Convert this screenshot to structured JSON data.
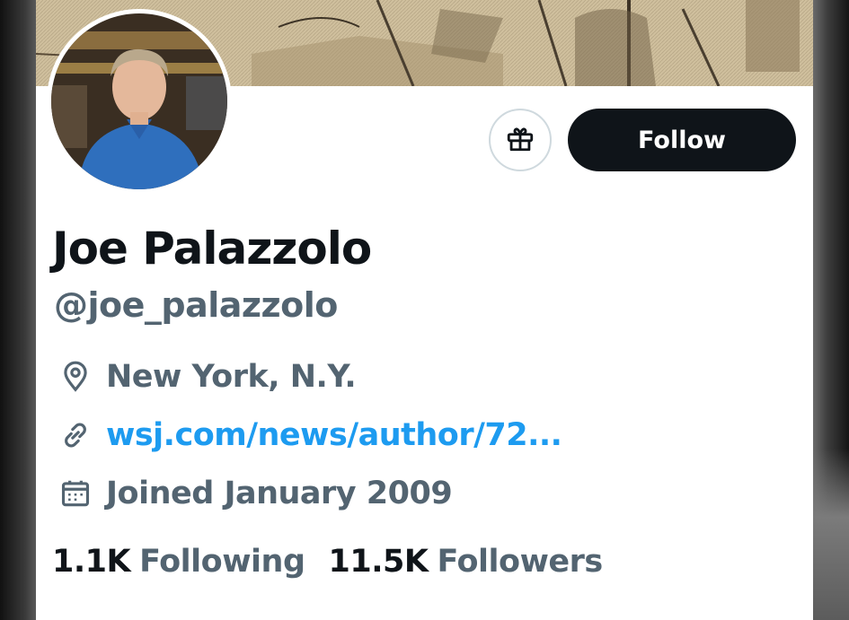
{
  "profile": {
    "name": "Joe Palazzolo",
    "handle": "@joe_palazzolo",
    "location": "New York, N.Y.",
    "website": "wsj.com/news/author/72...",
    "joined": "Joined January 2009"
  },
  "actions": {
    "follow_label": "Follow",
    "gift_icon": "gift-icon"
  },
  "stats": {
    "following_count": "1.1K",
    "following_label": "Following",
    "followers_count": "11.5K",
    "followers_label": "Followers"
  },
  "icons": {
    "location": "location-pin-icon",
    "link": "link-icon",
    "calendar": "calendar-icon"
  },
  "colors": {
    "primary_text": "#0f1419",
    "secondary_text": "#536471",
    "link": "#1d9bf0",
    "follow_button_bg": "#0f1419"
  }
}
